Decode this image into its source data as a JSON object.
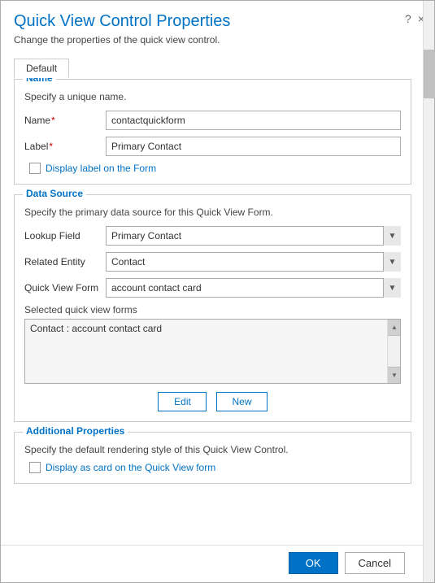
{
  "dialog": {
    "title": "Quick View Control Properties",
    "subtitle": "Change the properties of the quick view control.",
    "help_icon": "?",
    "close_icon": "×"
  },
  "tabs": [
    {
      "label": "Default"
    }
  ],
  "name_section": {
    "legend": "Name",
    "description": "Specify a unique name.",
    "name_label": "Name",
    "name_required": "*",
    "name_value": "contactquickform",
    "label_label": "Label",
    "label_required": "*",
    "label_value": "Primary Contact",
    "checkbox_label": "Display label on the Form"
  },
  "data_source_section": {
    "legend": "Data Source",
    "description": "Specify the primary data source for this Quick View Form.",
    "lookup_field_label": "Lookup Field",
    "lookup_field_value": "Primary Contact",
    "lookup_field_options": [
      "Primary Contact"
    ],
    "related_entity_label": "Related Entity",
    "related_entity_value": "Contact",
    "related_entity_options": [
      "Contact"
    ],
    "quick_view_form_label": "Quick View Form",
    "quick_view_form_value": "account contact card",
    "quick_view_form_options": [
      "account contact card"
    ],
    "selected_forms_label": "Selected quick view forms",
    "selected_forms_item": "Contact : account contact card",
    "edit_button": "Edit",
    "new_button": "New"
  },
  "additional_section": {
    "legend": "Additional Properties",
    "description": "Specify the default rendering style of this Quick View Control.",
    "checkbox_label": "Display as card on the Quick View form"
  },
  "footer": {
    "ok_label": "OK",
    "cancel_label": "Cancel"
  }
}
